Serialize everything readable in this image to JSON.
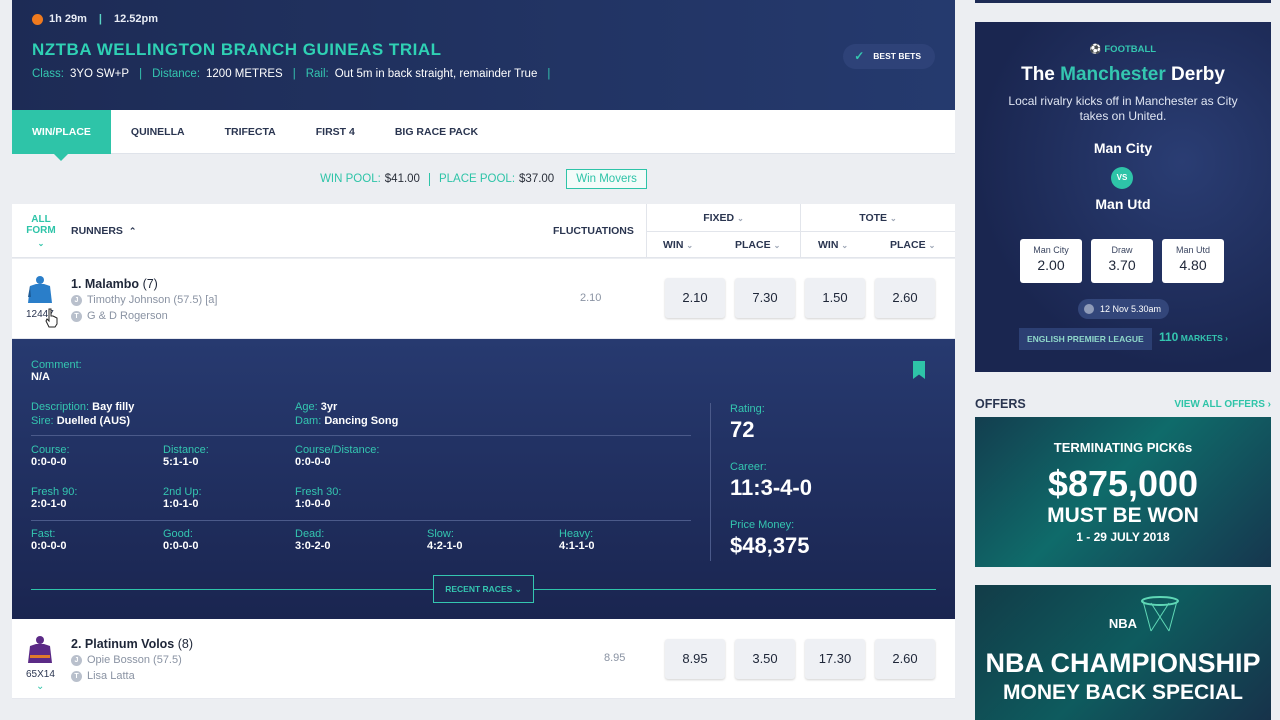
{
  "race": {
    "elapsed": "1h 29m",
    "time": "12.52pm",
    "title": "NZTBA WELLINGTON BRANCH GUINEAS TRIAL",
    "class_label": "Class:",
    "class_value": "3YO SW+P",
    "distance_label": "Distance:",
    "distance_value": "1200 METRES",
    "rail_label": "Rail:",
    "rail_value": "Out 5m in back straight, remainder True",
    "best_bets": "BEST BETS"
  },
  "tabs": [
    "WIN/PLACE",
    "QUINELLA",
    "TRIFECTA",
    "FIRST 4",
    "BIG RACE PACK"
  ],
  "pools": {
    "win_label": "WIN POOL:",
    "win_value": "$41.00",
    "place_label": "PLACE POOL:",
    "place_value": "$37.00",
    "movers": "Win Movers"
  },
  "table_head": {
    "all_form": "ALL FORM",
    "runners": "RUNNERS",
    "fluctuations": "FLUCTUATIONS",
    "fixed": "FIXED",
    "tote": "TOTE",
    "win": "WIN",
    "place": "PLACE"
  },
  "runners": [
    {
      "number_name": "1.  Malambo",
      "barrier": "(7)",
      "jockey": "Timothy Johnson (57.5) [a]",
      "trainer": "G & D Rogerson",
      "silk_code": "12447",
      "fluct": "2.10",
      "fixed_win": "2.10",
      "fixed_place": "7.30",
      "tote_win": "1.50",
      "tote_place": "2.60",
      "silk_color": "#2a7ec9"
    },
    {
      "number_name": "2.  Platinum Volos",
      "barrier": "(8)",
      "jockey": "Opie Bosson (57.5)",
      "trainer": "Lisa Latta",
      "silk_code": "65X14",
      "fluct": "8.95",
      "fixed_win": "8.95",
      "fixed_place": "3.50",
      "tote_win": "17.30",
      "tote_place": "2.60",
      "silk_color": "#5b2a86"
    }
  ],
  "detail": {
    "comment_label": "Comment:",
    "comment": "N/A",
    "description_label": "Description:",
    "description": "Bay filly",
    "sire_label": "Sire:",
    "sire": "Duelled (AUS)",
    "age_label": "Age:",
    "age": "3yr",
    "dam_label": "Dam:",
    "dam": "Dancing Song",
    "course_label": "Course:",
    "course": "0:0-0-0",
    "distance_label": "Distance:",
    "distance": "5:1-1-0",
    "coursedist_label": "Course/Distance:",
    "coursedist": "0:0-0-0",
    "fresh90_label": "Fresh 90:",
    "fresh90": "2:0-1-0",
    "secondup_label": "2nd Up:",
    "secondup": "1:0-1-0",
    "fresh30_label": "Fresh 30:",
    "fresh30": "1:0-0-0",
    "fast_label": "Fast:",
    "fast": "0:0-0-0",
    "good_label": "Good:",
    "good": "0:0-0-0",
    "dead_label": "Dead:",
    "dead": "3:0-2-0",
    "slow_label": "Slow:",
    "slow": "4:2-1-0",
    "heavy_label": "Heavy:",
    "heavy": "4:1-1-0",
    "rating_label": "Rating:",
    "rating": "72",
    "career_label": "Career:",
    "career": "11:3-4-0",
    "prize_label": "Price Money:",
    "prize": "$48,375",
    "recent_races": "RECENT RACES"
  },
  "promo": {
    "sport": "FOOTBALL",
    "title_a": "The ",
    "title_hl": "Manchester",
    "title_b": " Derby",
    "desc": "Local rivalry kicks off in Manchester as City takes on United.",
    "home": "Man City",
    "vs": "VS",
    "away": "Man Utd",
    "buttons": [
      {
        "label": "Man City",
        "odds": "2.00"
      },
      {
        "label": "Draw",
        "odds": "3.70"
      },
      {
        "label": "Man Utd",
        "odds": "4.80"
      }
    ],
    "kickoff": "12 Nov 5.30am",
    "league": "ENGLISH PREMIER LEAGUE",
    "markets_count": "110",
    "markets_label": "MARKETS"
  },
  "offers": {
    "heading": "OFFERS",
    "view_all": "VIEW ALL OFFERS",
    "b1_a": "TERMINATING PICK6s",
    "b1_b": "$875,000",
    "b1_c": "MUST BE WON",
    "b1_d": "1 - 29 JULY 2018",
    "b2_a": "NBA",
    "b2_b": "NBA CHAMPIONSHIP",
    "b2_c": "MONEY BACK SPECIAL"
  },
  "colors": {
    "accent": "#2ec4a8",
    "navy": "#1d2b55"
  }
}
